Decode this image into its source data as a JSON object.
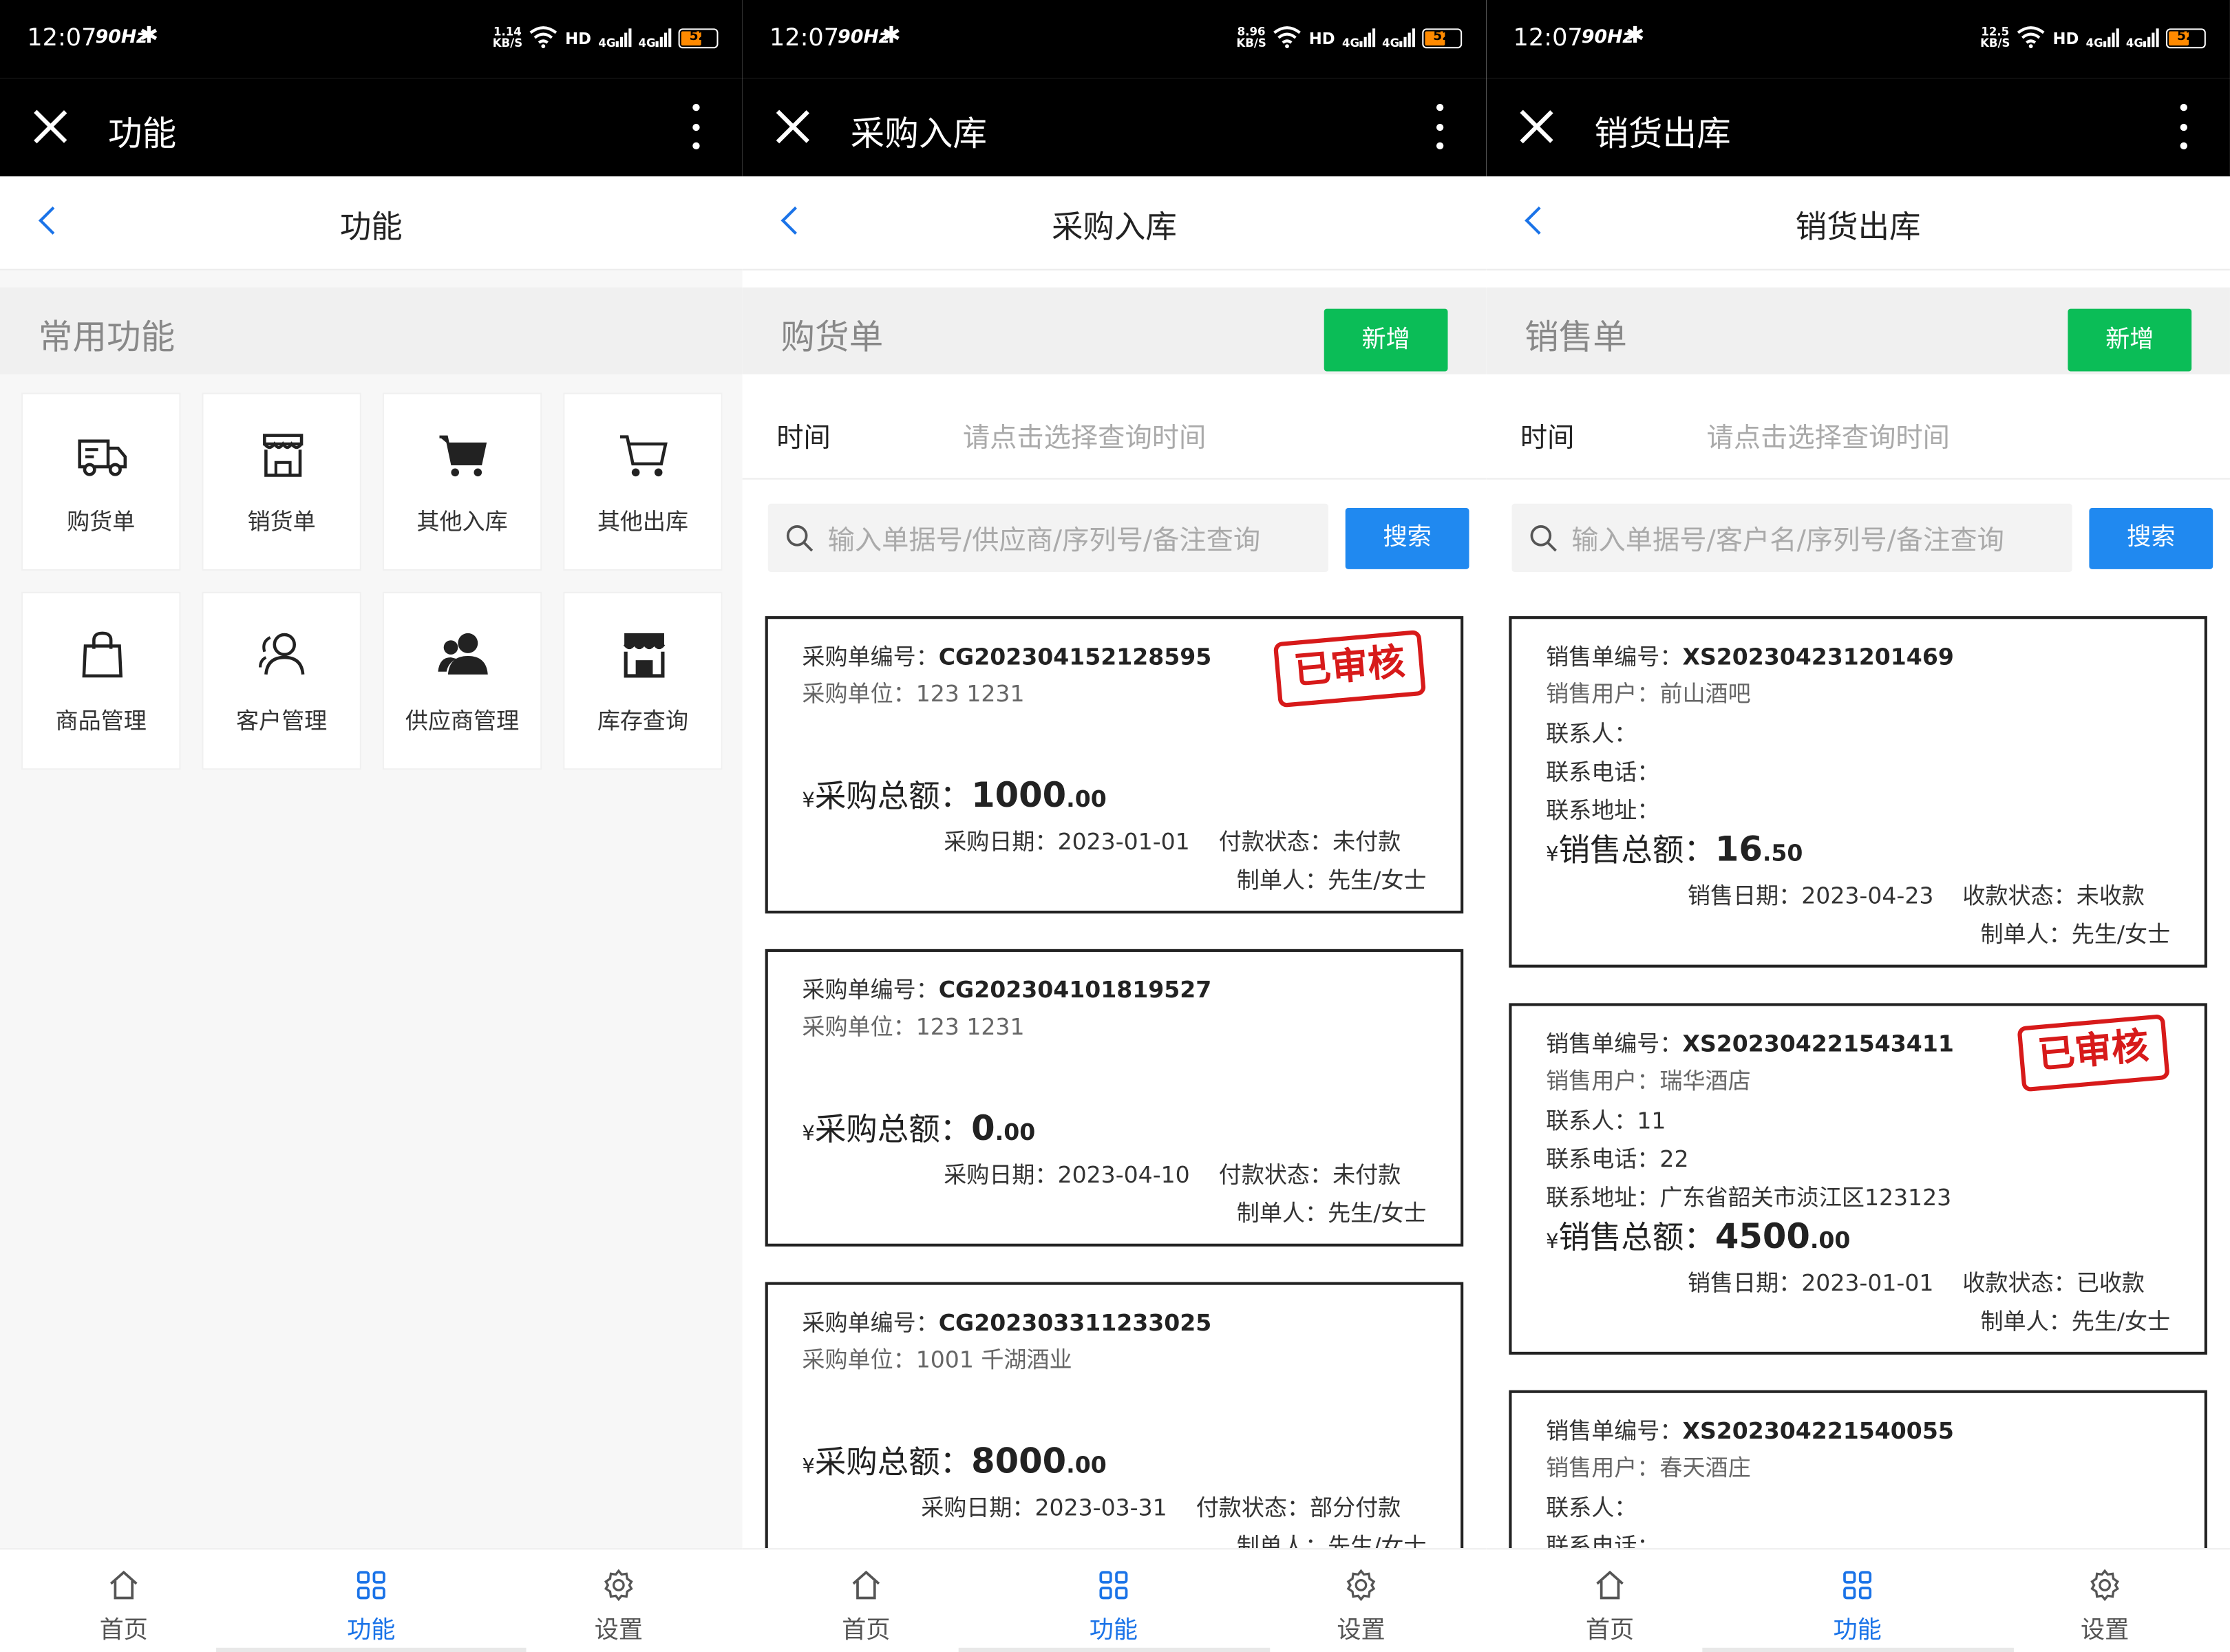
{
  "status": {
    "time": "12:07",
    "hz": "90Hz",
    "hd": "HD",
    "net": "4G",
    "battery": "52",
    "speeds": [
      "1.14",
      "8.96",
      "12.5"
    ],
    "speed_unit": "KB/S"
  },
  "panels": [
    {
      "header_title": "功能",
      "nav_title": "功能",
      "section_title": "常用功能"
    },
    {
      "header_title": "采购入库",
      "nav_title": "采购入库",
      "section_title": "购货单"
    },
    {
      "header_title": "销货出库",
      "nav_title": "销货出库",
      "section_title": "销售单"
    }
  ],
  "functions": [
    {
      "label": "购货单",
      "icon": "truck-icon"
    },
    {
      "label": "销货单",
      "icon": "store-icon"
    },
    {
      "label": "其他入库",
      "icon": "cart-filled-icon"
    },
    {
      "label": "其他出库",
      "icon": "cart-outline-icon"
    },
    {
      "label": "商品管理",
      "icon": "bag-icon"
    },
    {
      "label": "客户管理",
      "icon": "customers-icon"
    },
    {
      "label": "供应商管理",
      "icon": "suppliers-icon"
    },
    {
      "label": "库存查询",
      "icon": "warehouse-icon"
    }
  ],
  "add_label": "新增",
  "search_label": "搜索",
  "time_label": "时间",
  "time_placeholder": "请点击选择查询时间",
  "purchase_search_placeholder": "输入单据号/供应商/序列号/备注查询",
  "sales_search_placeholder": "输入单据号/客户名/序列号/备注查询",
  "stamp_text": "已审核",
  "purchase_orders": [
    {
      "no_label": "采购单编号：",
      "no": "CG202304152128595",
      "unit_label": "采购单位：",
      "unit": "123 1231",
      "total_label": "采购总额：",
      "yen": "¥",
      "amount": "1000",
      "decimal": ".00",
      "date_label": "采购日期：",
      "date": "2023-01-01",
      "status_label": "付款状态：",
      "status": "未付款",
      "maker_label": "制单人：",
      "maker": "先生/女士",
      "approved": true
    },
    {
      "no_label": "采购单编号：",
      "no": "CG202304101819527",
      "unit_label": "采购单位：",
      "unit": "123 1231",
      "total_label": "采购总额：",
      "yen": "¥",
      "amount": "0",
      "decimal": ".00",
      "date_label": "采购日期：",
      "date": "2023-04-10",
      "status_label": "付款状态：",
      "status": "未付款",
      "maker_label": "制单人：",
      "maker": "先生/女士",
      "approved": false
    },
    {
      "no_label": "采购单编号：",
      "no": "CG202303311233025",
      "unit_label": "采购单位：",
      "unit": "1001 千湖酒业",
      "total_label": "采购总额：",
      "yen": "¥",
      "amount": "8000",
      "decimal": ".00",
      "date_label": "采购日期：",
      "date": "2023-03-31",
      "status_label": "付款状态：",
      "status": "部分付款",
      "maker_label": "制单人：",
      "maker": "先生/女士",
      "approved": false
    }
  ],
  "sales_orders": [
    {
      "no_label": "销售单编号：",
      "no": "XS202304231201469",
      "user_label": "销售用户：",
      "user": "前山酒吧",
      "contact_label": "联系人：",
      "contact": "",
      "phone_label": "联系电话：",
      "phone": "",
      "addr_label": "联系地址：",
      "addr": "",
      "total_label": "销售总额：",
      "yen": "¥",
      "amount": "16",
      "decimal": ".50",
      "date_label": "销售日期：",
      "date": "2023-04-23",
      "status_label": "收款状态：",
      "status": "未收款",
      "maker_label": "制单人：",
      "maker": "先生/女士",
      "approved": false
    },
    {
      "no_label": "销售单编号：",
      "no": "XS202304221543411",
      "user_label": "销售用户：",
      "user": "瑞华酒店",
      "contact_label": "联系人：",
      "contact": "11",
      "phone_label": "联系电话：",
      "phone": "22",
      "addr_label": "联系地址：",
      "addr": "广东省韶关市浈江区123123",
      "total_label": "销售总额：",
      "yen": "¥",
      "amount": "4500",
      "decimal": ".00",
      "date_label": "销售日期：",
      "date": "2023-01-01",
      "status_label": "收款状态：",
      "status": "已收款",
      "maker_label": "制单人：",
      "maker": "先生/女士",
      "approved": true
    },
    {
      "no_label": "销售单编号：",
      "no": "XS202304221540055",
      "user_label": "销售用户：",
      "user": "春天酒庄",
      "contact_label": "联系人：",
      "contact": "",
      "phone_label": "联系电话：",
      "phone": "",
      "approved": false
    }
  ],
  "tabs": [
    {
      "label": "首页",
      "icon": "home-icon",
      "active": false
    },
    {
      "label": "功能",
      "icon": "grid-icon",
      "active": true
    },
    {
      "label": "设置",
      "icon": "gear-icon",
      "active": false
    }
  ],
  "colors": {
    "accent": "#1a73e8",
    "add_button": "#0bbd57",
    "search_button": "#2089f0",
    "stamp": "#d71a1a",
    "header": "#000000"
  }
}
